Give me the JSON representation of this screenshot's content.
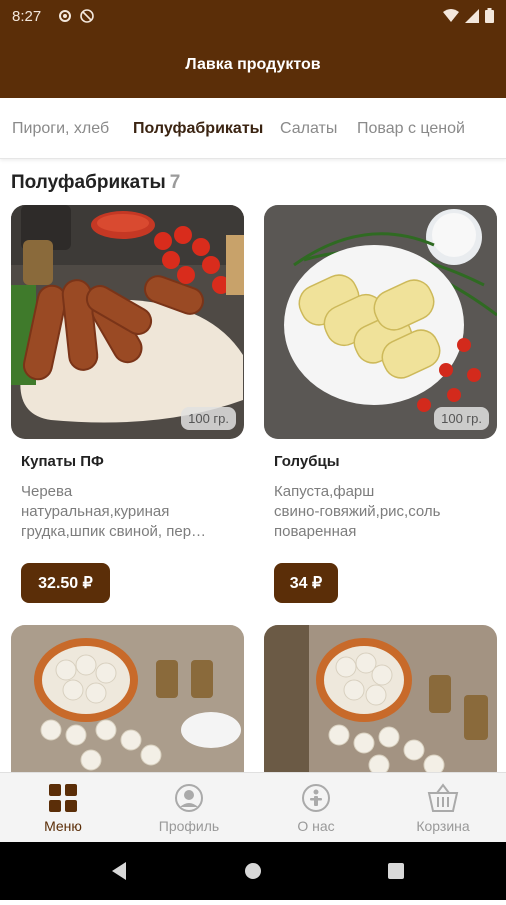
{
  "status_bar": {
    "time": "8:27"
  },
  "app_bar": {
    "title": "Лавка продуктов"
  },
  "tabs": [
    {
      "label": "Пироги, хлеб"
    },
    {
      "label": "Полуфабрикаты"
    },
    {
      "label": "Салаты"
    },
    {
      "label": "Повар с ценой"
    }
  ],
  "section": {
    "title": "Полуфабрикаты",
    "count": "7"
  },
  "products": [
    {
      "name": "Купаты ПФ",
      "weight": "100 гр.",
      "desc1": "Черева",
      "desc2": "натуральная,куриная",
      "desc3": "грудка,шпик свиной, пер…",
      "price": "32.50 ₽"
    },
    {
      "name": "Голубцы",
      "weight": "100 гр.",
      "desc1": "Капуста,фарш",
      "desc2": "свино-говяжий,рис,соль",
      "desc3": "поваренная",
      "price": "34 ₽"
    }
  ],
  "bottom_nav": [
    {
      "label": "Меню",
      "icon": "menu-grid-icon"
    },
    {
      "label": "Профиль",
      "icon": "profile-icon"
    },
    {
      "label": "О нас",
      "icon": "about-icon"
    },
    {
      "label": "Корзина",
      "icon": "basket-icon"
    }
  ],
  "colors": {
    "brand": "#5b2e08",
    "inactive": "#999999"
  }
}
